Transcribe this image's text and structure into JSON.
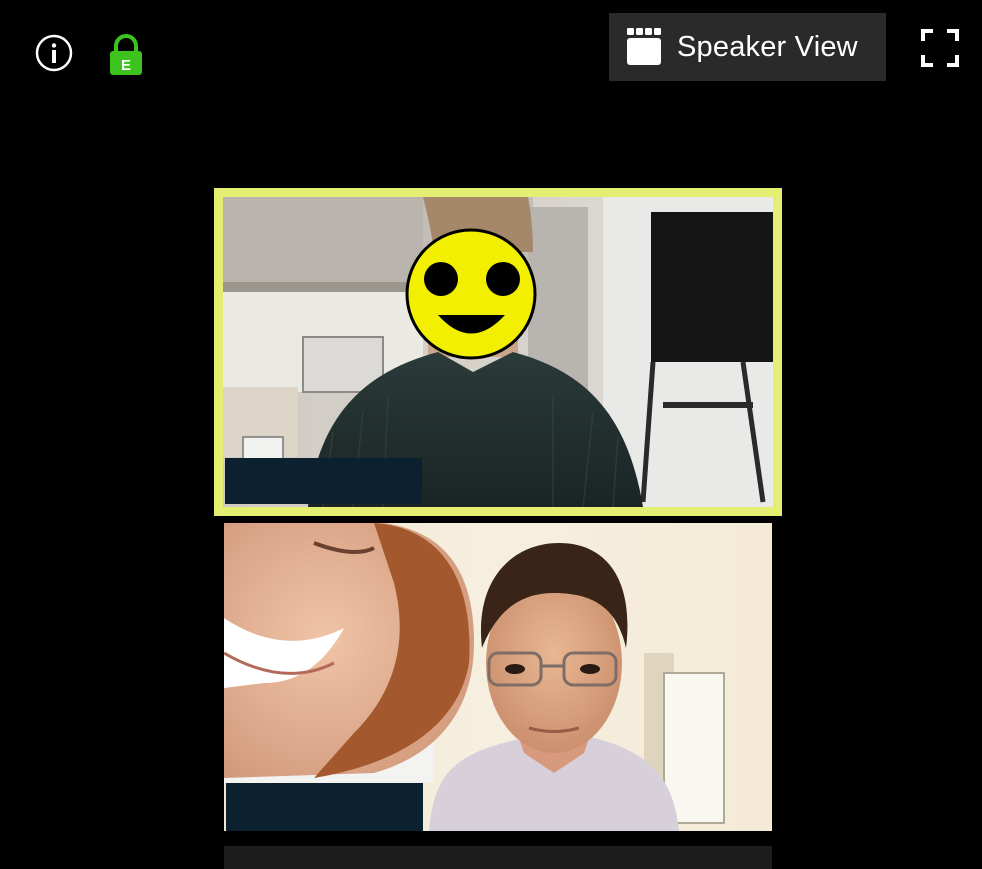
{
  "toolbar": {
    "info_icon": "info-icon",
    "lock_icon": "lock-icon",
    "lock_badge": "E",
    "speaker_view_label": "Speaker View",
    "speaker_view_icon": "gallery-grid-icon",
    "fullscreen_icon": "fullscreen-icon"
  },
  "participants": [
    {
      "name": "",
      "active_speaker": true,
      "face_overlay": "smiley-face-icon"
    },
    {
      "name": "",
      "active_speaker": false
    }
  ],
  "colors": {
    "background": "#000000",
    "active_border": "#e3ee72",
    "lock_green": "#3cc31e",
    "name_bar": "#0c2130",
    "button_bg": "#2a2a2a"
  }
}
